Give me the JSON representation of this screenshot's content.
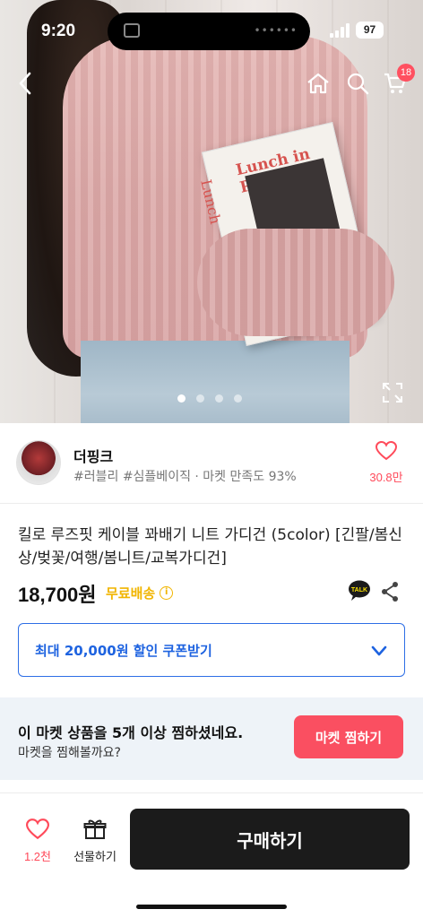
{
  "status_bar": {
    "time": "9:20",
    "battery": "97"
  },
  "nav": {
    "back_icon": "chevron-left-icon",
    "home_icon": "home-icon",
    "search_icon": "search-icon",
    "cart_icon": "cart-icon",
    "cart_badge": "18"
  },
  "hero": {
    "book_title": "Lunch in Paris",
    "book_spine": "Lunch",
    "pager": {
      "count": 4,
      "active": 0
    },
    "expand_icon": "expand-icon"
  },
  "shop": {
    "name": "더핑크",
    "tags": "#러블리 #심플베이직 · 마켓 만족도 93%",
    "favorite_count": "30.8만"
  },
  "product": {
    "title": "킬로 루즈핏 케이블 꽈배기 니트 가디건 (5color) [긴팔/봄신상/벚꽃/여행/봄니트/교복가디건]",
    "price": "18,700원",
    "shipping": "무료배송",
    "info_icon": "ⓘ",
    "talk_icon": "kakao-talk-icon",
    "share_icon": "share-icon"
  },
  "coupon": {
    "label": "최대 20,000원 할인 쿠폰받기"
  },
  "banner": {
    "title": "이 마켓 상품을 5개 이상 찜하셨네요.",
    "subtitle": "마켓을 찜해볼까요?",
    "button": "마켓 찜하기"
  },
  "bottom_bar": {
    "like_count": "1.2천",
    "gift_label": "선물하기",
    "buy_label": "구매하기"
  },
  "colors": {
    "accent_red": "#ff4a5a",
    "coupon_blue": "#1e63e0",
    "shipping_yellow": "#f1b500",
    "buy_button": "#1b1b1b"
  }
}
